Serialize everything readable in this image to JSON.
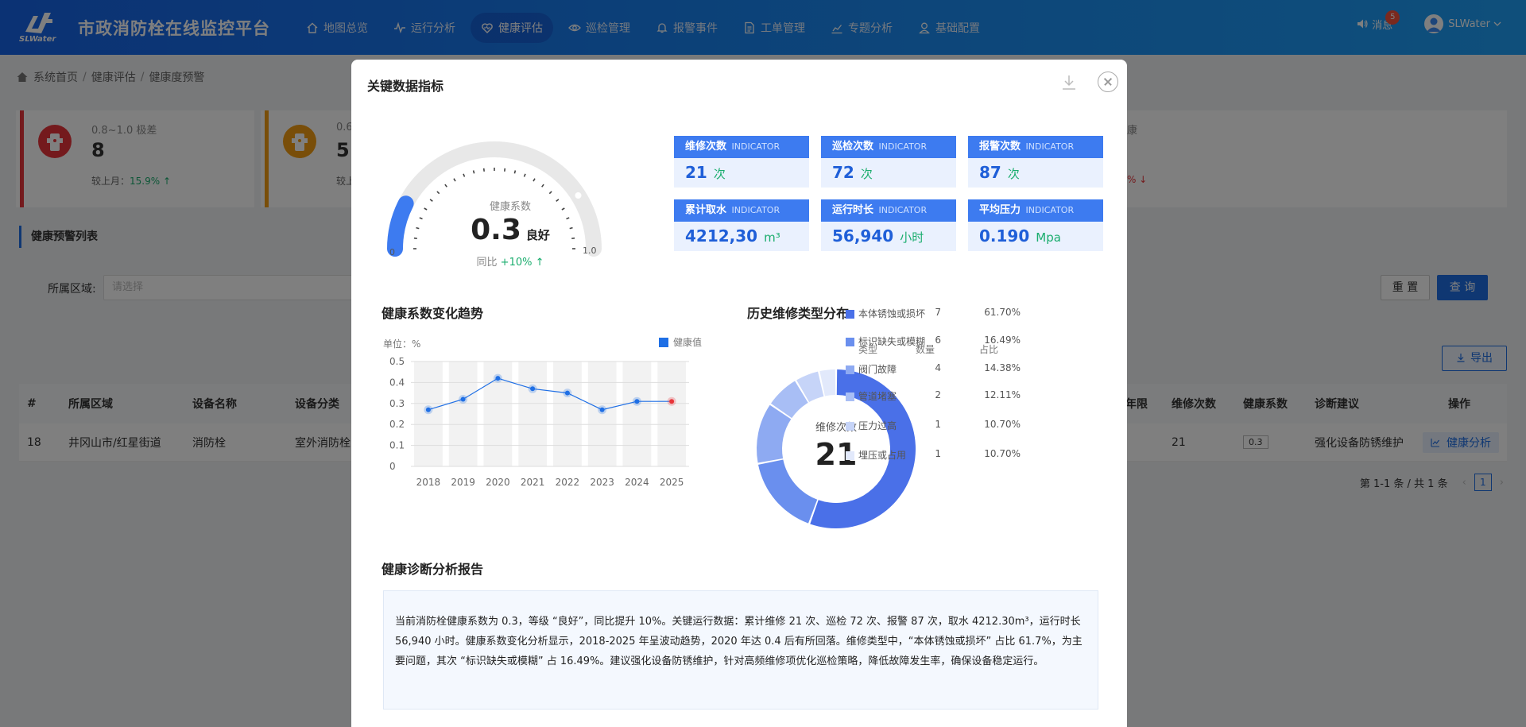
{
  "app": {
    "logo_text": "SLWater",
    "title": "市政消防栓在线监控平台"
  },
  "nav": {
    "items": [
      {
        "label": "地图总览",
        "icon": "home-icon"
      },
      {
        "label": "运行分析",
        "icon": "pulse-icon"
      },
      {
        "label": "健康评估",
        "icon": "heart-icon",
        "active": true
      },
      {
        "label": "巡检管理",
        "icon": "eye-icon"
      },
      {
        "label": "报警事件",
        "icon": "bell-icon"
      },
      {
        "label": "工单管理",
        "icon": "document-icon"
      },
      {
        "label": "专题分析",
        "icon": "chart-icon"
      },
      {
        "label": "基础配置",
        "icon": "user-settings-icon"
      }
    ]
  },
  "header_right": {
    "message_label": "消息",
    "message_count": "5",
    "user_name": "SLWater"
  },
  "breadcrumb": [
    "系统首页",
    "健康评估",
    "健康度预警"
  ],
  "stats": [
    {
      "label": "0.8~1.0 极差",
      "value": "8",
      "compare_label": "较上月：",
      "compare_value": "15.9% ↑"
    },
    {
      "label": "0.6",
      "value": "5",
      "compare_label": "较上",
      "compare_value": ""
    }
  ],
  "stat_right_fragment": {
    "label": "康",
    "compare_value": "% ↓"
  },
  "list": {
    "title": "健康预警列表",
    "filter_label": "所属区域:",
    "filter_placeholder": "请选择",
    "reset_label": "重 置",
    "query_label": "查 询",
    "export_label": "导出",
    "columns": [
      "#",
      "所属区域",
      "设备名称",
      "设备分类",
      "年限",
      "维修次数",
      "健康系数",
      "诊断建议",
      "操作"
    ],
    "rows": [
      {
        "index": "18",
        "area": "井冈山市/红星街道",
        "device": "消防栓",
        "category": "室外消防栓",
        "repairs": "21",
        "score": "0.3",
        "advice": "强化设备防锈维护",
        "action": "健康分析"
      }
    ],
    "pager_text": "第 1-1 条 / 共 1 条",
    "page": "1"
  },
  "modal": {
    "title": "关键数据指标",
    "gauge": {
      "title": "健康系数",
      "value": 0.3,
      "value_text": "0.3",
      "level": "良好",
      "yoy_label": "同比",
      "yoy_value": "+10% ↑",
      "min": "0",
      "max": "1.0",
      "fill_color": "#3d7bf0"
    },
    "kpis": [
      {
        "label": "维修次数",
        "en": "INDICATOR",
        "value": "21",
        "unit": "次"
      },
      {
        "label": "巡检次数",
        "en": "INDICATOR",
        "value": "72",
        "unit": "次"
      },
      {
        "label": "报警次数",
        "en": "INDICATOR",
        "value": "87",
        "unit": "次"
      },
      {
        "label": "累计取水",
        "en": "INDICATOR",
        "value": "4212,30",
        "unit": "m³"
      },
      {
        "label": "运行时长",
        "en": "INDICATOR",
        "value": "56,940",
        "unit": "小时"
      },
      {
        "label": "平均压力",
        "en": "INDICATOR",
        "value": "0.190",
        "unit": "Mpa"
      }
    ],
    "trend_title": "健康系数变化趋势",
    "trend_unit": "单位：%",
    "distribution_title": "历史维修类型分布",
    "donut_label": "维修次数",
    "donut_total": "21",
    "dist_headers": [
      "类型",
      "数量",
      "占比"
    ],
    "report_title": "健康诊断分析报告",
    "report_text": "当前消防栓健康系数为 0.3，等级 “良好”，同比提升 10%。关键运行数据：累计维修 21 次、巡检 72 次、报警 87 次，取水 4212.30m³，运行时长 56,940 小时。健康系数变化分析显示，2018-2025 年呈波动趋势，2020 年达 0.4 后有所回落。维修类型中，“本体锈蚀或损坏” 占比 61.7%，为主要问题，其次 “标识缺失或模糊” 占 16.49%。建议强化设备防锈维护，针对高频维修项优化巡检策略，降低故障发生率，确保设备稳定运行。"
  },
  "chart_data": [
    {
      "type": "line",
      "x": [
        "2018",
        "2019",
        "2020",
        "2021",
        "2022",
        "2023",
        "2024",
        "2025"
      ],
      "series": [
        {
          "name": "健康值",
          "values": [
            0.27,
            0.32,
            0.42,
            0.37,
            0.35,
            0.27,
            0.31,
            0.31
          ]
        }
      ],
      "xlabel": "",
      "ylabel": "单位：%",
      "ylim": [
        0,
        0.5
      ],
      "yticks": [
        "0",
        "0.1",
        "0.2",
        "0.3",
        "0.4",
        "0.5"
      ],
      "legend": "top-right",
      "color": "#1f6fe5",
      "highlight_last_color": "#e8353a",
      "grid": true
    },
    {
      "type": "pie",
      "categories": [
        "本体锈蚀或损坏",
        "标识缺失或模糊",
        "阀门故障",
        "管道堵塞",
        "压力过高",
        "埋压或占用"
      ],
      "counts": [
        7,
        6,
        4,
        2,
        1,
        1
      ],
      "percent_labels": [
        "61.70%",
        "16.49%",
        "14.38%",
        "12.11%",
        "10.70%",
        "10.70%"
      ],
      "slice_shares": [
        0.555,
        0.165,
        0.125,
        0.07,
        0.05,
        0.035
      ],
      "colors": [
        "#4a70e8",
        "#6a8fee",
        "#8eaaf2",
        "#a8bef5",
        "#c6d4f8",
        "#e2e9fb"
      ],
      "legend": "right"
    }
  ]
}
